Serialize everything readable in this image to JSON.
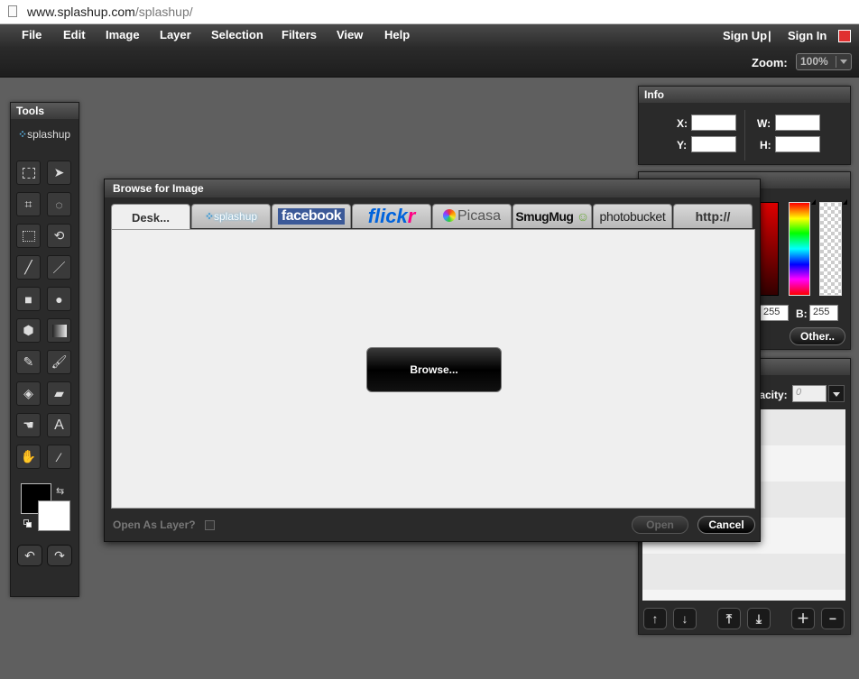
{
  "browser": {
    "url_host": "www.splashup.com",
    "url_path": "/splashup/"
  },
  "menu": {
    "items": [
      "File",
      "Edit",
      "Image",
      "Layer",
      "Selection",
      "Filters",
      "View",
      "Help"
    ],
    "sign_up": "Sign Up",
    "separator": "|",
    "sign_in": "Sign In"
  },
  "zoom": {
    "label": "Zoom:",
    "value": "100%"
  },
  "tools": {
    "title": "Tools",
    "logo_text": "splashup",
    "foreground_color": "#000000",
    "background_color": "#ffffff"
  },
  "info": {
    "title": "Info",
    "x_label": "X:",
    "y_label": "Y:",
    "w_label": "W:",
    "h_label": "H:"
  },
  "color": {
    "g_value": "255",
    "b_label": "B:",
    "b_value": "255",
    "other_label": "Other.."
  },
  "layers": {
    "opacity_label": "pacity:",
    "opacity_value": "0"
  },
  "dialog": {
    "title": "Browse for Image",
    "tabs": {
      "desktop": "Desk...",
      "splashup": "splashup",
      "facebook": "facebook",
      "flickr_a": "flick",
      "flickr_b": "r",
      "picasa": "Picasa",
      "smugmug": "SmugMug",
      "photobucket": "photobucket",
      "http": "http://"
    },
    "browse_label": "Browse...",
    "open_as_layer_label": "Open As Layer?",
    "open_label": "Open",
    "cancel_label": "Cancel"
  }
}
